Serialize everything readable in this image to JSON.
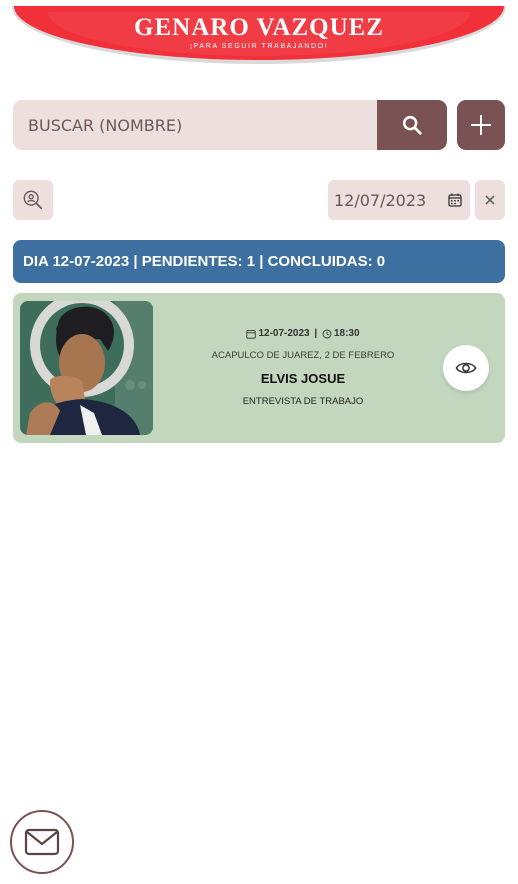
{
  "header": {
    "title": "GENARO VAZQUEZ",
    "subtitle": "¡PARA SEGUIR TRABAJANDO!",
    "color": "#f2303a"
  },
  "search": {
    "placeholder": "BUSCAR (NOMBRE)",
    "value": "",
    "button_icon": "search-icon"
  },
  "add_button": {
    "icon": "plus-icon"
  },
  "filters": {
    "user_filter_icon": "user-search-icon",
    "date_value": "12/07/2023",
    "calendar_icon": "calendar-icon",
    "clear_icon": "close-icon"
  },
  "summary": {
    "text": "DIA 12-07-2023 | PENDIENTES: 1 | CONCLUIDAS: 0",
    "color": "#3d70a0"
  },
  "appointments": [
    {
      "date": "12-07-2023",
      "time": "18:30",
      "location": "ACAPULCO DE JUAREZ, 2 DE FEBRERO",
      "name": "ELVIS JOSUE",
      "type": "ENTREVISTA DE TRABAJO",
      "view_icon": "eye-icon",
      "card_color": "#c3d7bf"
    }
  ],
  "mail_button": {
    "icon": "mail-icon"
  },
  "theme": {
    "accent": "#7a5254",
    "field_bg": "#eedfdf"
  }
}
